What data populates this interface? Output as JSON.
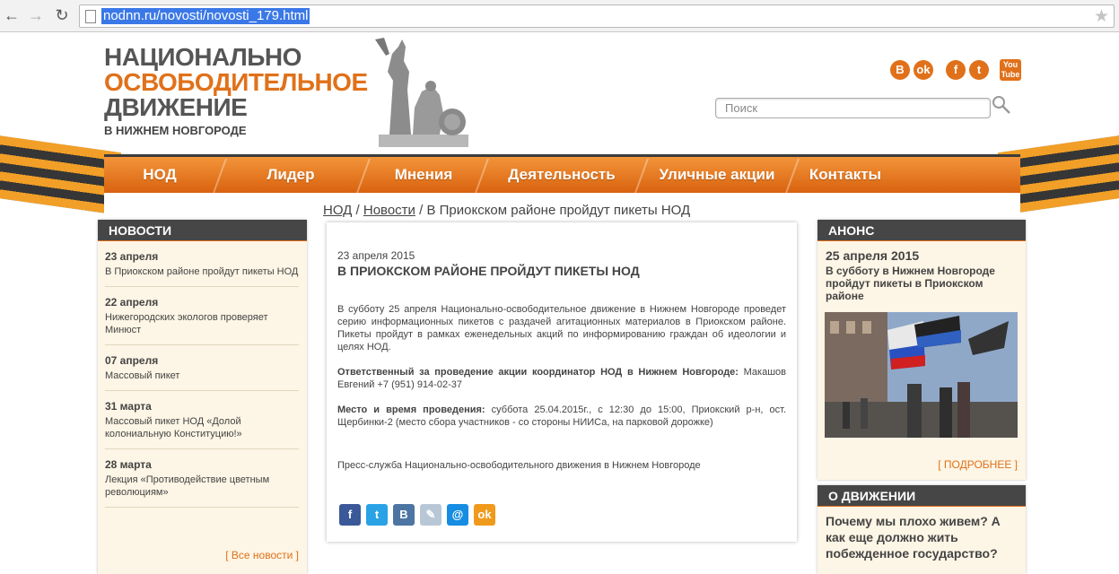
{
  "browser": {
    "url": "nodnn.ru/novosti/novosti_179.html"
  },
  "logo": {
    "line1": "НАЦИОНАЛЬНО",
    "line2": "ОСВОБОДИТЕЛЬНОЕ",
    "line3": "ДВИЖЕНИЕ",
    "line4": "В НИЖНЕМ НОВГОРОДЕ"
  },
  "socials": [
    "vk",
    "ok",
    "facebook",
    "twitter",
    "youtube"
  ],
  "search": {
    "placeholder": "Поиск"
  },
  "nav": {
    "items": [
      "НОД",
      "Лидер",
      "Мнения",
      "Деятельность",
      "Уличные акции",
      "Контакты"
    ]
  },
  "breadcrumb": {
    "home": "НОД",
    "sep1": "/",
    "section": "Новости",
    "sep2": "/",
    "current": "В Приокском районе пройдут пикеты НОД"
  },
  "news": {
    "title": "НОВОСТИ",
    "items": [
      {
        "date": "23 апреля",
        "text": "В Приокском районе пройдут пикеты НОД"
      },
      {
        "date": "22 апреля",
        "text": "Нижегородских экологов проверяет Минюст"
      },
      {
        "date": "07 апреля",
        "text": "Массовый пикет"
      },
      {
        "date": "31 марта",
        "text": "Массовый пикет НОД «Долой колониальную Конституцию!»"
      },
      {
        "date": "28 марта",
        "text": "Лекция «Противодействие цветным революциям»"
      }
    ],
    "all_link": "[ Все новости ]"
  },
  "article": {
    "date": "23 апреля 2015",
    "title": "В ПРИОКСКОМ РАЙОНЕ ПРОЙДУТ ПИКЕТЫ НОД",
    "p1": "В субботу 25 апреля Национально-освободительное движение в Нижнем Новгороде проведет серию информационных пикетов с раздачей агитационных материалов в Приокском районе. Пикеты пройдут в рамках еженедельных акций по информированию граждан об идеологии и целях НОД.",
    "p2_bold": "Ответственный за проведение акции координатор НОД в Нижнем Новгороде:",
    "p2_text": " Макашов Евгений +7 (951) 914-02-37",
    "p3_bold": "Место и время проведения:",
    "p3_text": " суббота 25.04.2015г., с 12:30 до 15:00, Приокский р-н, ост. Щербинки-2 (место сбора участников - со стороны НИИСа, на парковой дорожке)",
    "press": "Пресс-служба Национально-освободительного движения в Нижнем Новгороде"
  },
  "share": [
    {
      "icon": "facebook",
      "color": "#3b5998",
      "glyph": "f"
    },
    {
      "icon": "twitter",
      "color": "#2aa3e6",
      "glyph": "t"
    },
    {
      "icon": "vk",
      "color": "#4c75a3",
      "glyph": "B"
    },
    {
      "icon": "livejournal",
      "color": "#b8c7d6",
      "glyph": "✎"
    },
    {
      "icon": "mailru",
      "color": "#168de2",
      "glyph": "@"
    },
    {
      "icon": "odnoklassniki",
      "color": "#f09a1c",
      "glyph": "ok"
    }
  ],
  "announce": {
    "title": "АНОНС",
    "date": "25 апреля 2015",
    "text": "В субботу в Нижнем Новгороде пройдут пикеты в Приокском районе",
    "more": "[ ПОДРОБНЕЕ ]"
  },
  "about": {
    "title": "О ДВИЖЕНИИ",
    "question": "Почему мы плохо живем? А как еще должно жить побежденное государство?"
  },
  "colors": {
    "accent": "#e0711a",
    "dark": "#464646",
    "sidebar_bg": "#fdf5e5"
  }
}
